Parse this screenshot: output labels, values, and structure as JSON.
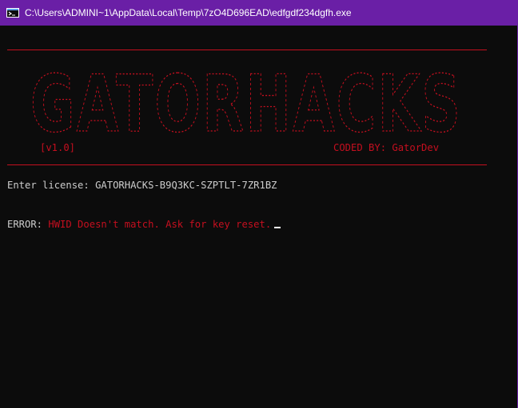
{
  "window": {
    "title": "C:\\Users\\ADMINI~1\\AppData\\Local\\Temp\\7zO4D696EAD\\edfgdf234dgfh.exe",
    "icon": "console-app-icon"
  },
  "banner": {
    "logo_text": "GATORHACKS",
    "version": "[v1.0]",
    "coded_by": "CODED BY: GatorDev"
  },
  "console": {
    "license_prompt": "Enter license: ",
    "license_value": "GATORHACKS-B9Q3KC-SZPTLT-7ZR1BZ",
    "error_label": "ERROR: ",
    "error_message": "HWID Doesn't match. Ask for key reset."
  },
  "colors": {
    "title_bar": "#6a1fa6",
    "background": "#0c0c0c",
    "text": "#cccccc",
    "accent_red": "#c50f1f"
  }
}
